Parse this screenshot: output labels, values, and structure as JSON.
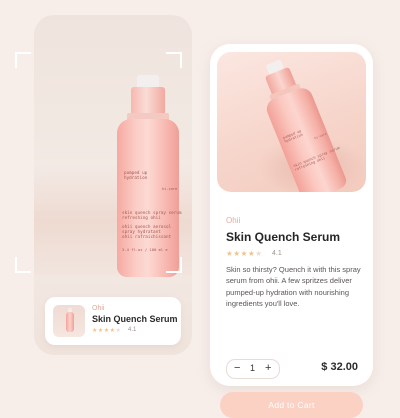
{
  "scanner": {
    "bottle_label": {
      "line1": "pumped up\nhydration",
      "line2": "skin quench spray serum\nrefreshing ohii",
      "line3": "ohii quench aerosol\nspray hydratant\nohii rafraichissant",
      "side": "hi-care",
      "volume": "3.4 fl.oz / 100 ml e"
    },
    "result_card": {
      "brand": "Ohii",
      "name": "Skin Quench Serum",
      "rating": "4.1"
    }
  },
  "product": {
    "brand": "Ohii",
    "name": "Skin Quench Serum",
    "rating": "4.1",
    "stars_filled": 4,
    "stars_total": 5,
    "description": "Skin so thirsty? Quench it with this spray serum from ohii. A few spritzes deliver pumped-up hydration with nourishing ingredients you'll love.",
    "quantity": "1",
    "minus_symbol": "−",
    "plus_symbol": "+",
    "price": "$ 32.00",
    "cta_label": "Add to Cart",
    "hero_label": {
      "line1": "pumped up\nhydration",
      "line2": "skin quench spray serum\nrefreshing ohii",
      "side": "hi-care"
    }
  },
  "colors": {
    "accent": "#fbd1c3",
    "star": "#f2c38a",
    "brand_text": "#e6ab9f"
  }
}
